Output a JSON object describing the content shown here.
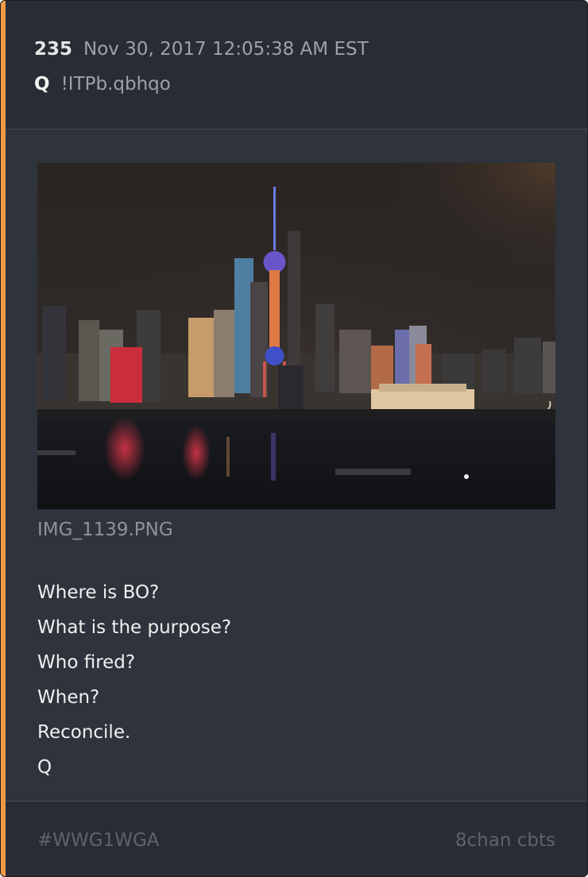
{
  "post": {
    "number": "235",
    "datetime": "Nov 30, 2017 12:05:38 AM EST",
    "author": "Q",
    "tripcode": "!ITPb.qbhqo"
  },
  "attachment": {
    "filename": "IMG_1139.PNG",
    "image_description": "night-skyline-photo"
  },
  "message": {
    "lines": [
      "Where is BO?",
      "What is the purpose?",
      "Who fired?",
      "When?",
      "Reconcile.",
      "Q"
    ]
  },
  "footer": {
    "hashtag": "#WWG1WGA",
    "source": "8chan cbts"
  },
  "colors": {
    "accent": "#f29a44",
    "card_background": "#2e333c",
    "header_background": "#282c34"
  }
}
